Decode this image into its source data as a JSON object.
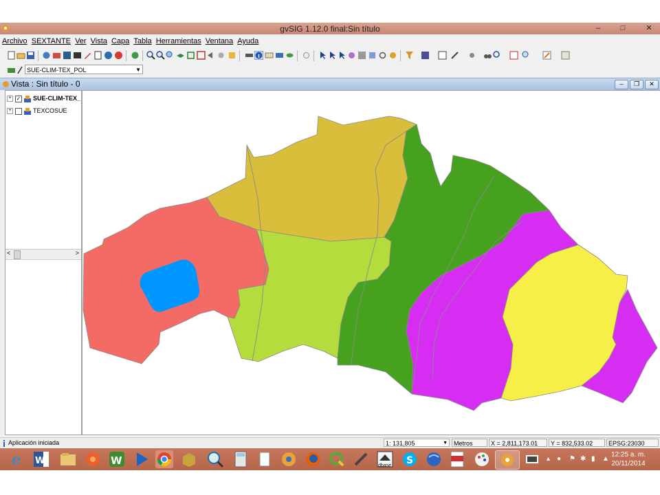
{
  "window": {
    "title": "gvSIG 1.12.0 final:Sin título",
    "controls": [
      "–",
      "□",
      "✕"
    ]
  },
  "menu": [
    "Archivo",
    "SEXTANTE",
    "Ver",
    "Vista",
    "Capa",
    "Tabla",
    "Herramientas",
    "Ventana",
    "Ayuda"
  ],
  "layer_combo": {
    "value": "SUE-CLIM-TEX_POL"
  },
  "view": {
    "title": "Vista : Sin título - 0"
  },
  "toc": {
    "layers": [
      {
        "name": "SUE-CLIM-TEX_",
        "checked": true
      },
      {
        "name": "TEXCOSUE",
        "checked": false
      }
    ],
    "scroll_left": "<",
    "scroll_right": ">"
  },
  "map": {
    "region_colors": {
      "red": "#f46a65",
      "blue": "#0096ff",
      "mustard": "#d8be3a",
      "lime": "#b5dc3d",
      "green": "#45a11e",
      "magenta": "#d72df2",
      "yellow": "#f6ef48"
    }
  },
  "status": {
    "message": "Aplicación iniciada",
    "scale": "1: 131,805",
    "units": "Metros",
    "x": "X = 2,811,173.01",
    "y": "Y = 832,533.02",
    "epsg": "EPSG:23030"
  },
  "taskbar": {
    "apps": [
      "ie-icon",
      "word-icon",
      "explorer-icon",
      "app-icon",
      "w-icon",
      "media-icon",
      "chrome-icon",
      "box-icon",
      "search-icon",
      "calc-icon",
      "file-icon",
      "gvsig-icon",
      "firefox-icon",
      "qgis-icon",
      "tool-icon",
      "dbase-icon",
      "skype-icon",
      "earth-icon",
      "pdf-icon",
      "paint-icon",
      "gvsig-active-icon"
    ],
    "dbase_label": "dbase",
    "time": "12:25 a. m.",
    "date": "20/11/2014"
  }
}
